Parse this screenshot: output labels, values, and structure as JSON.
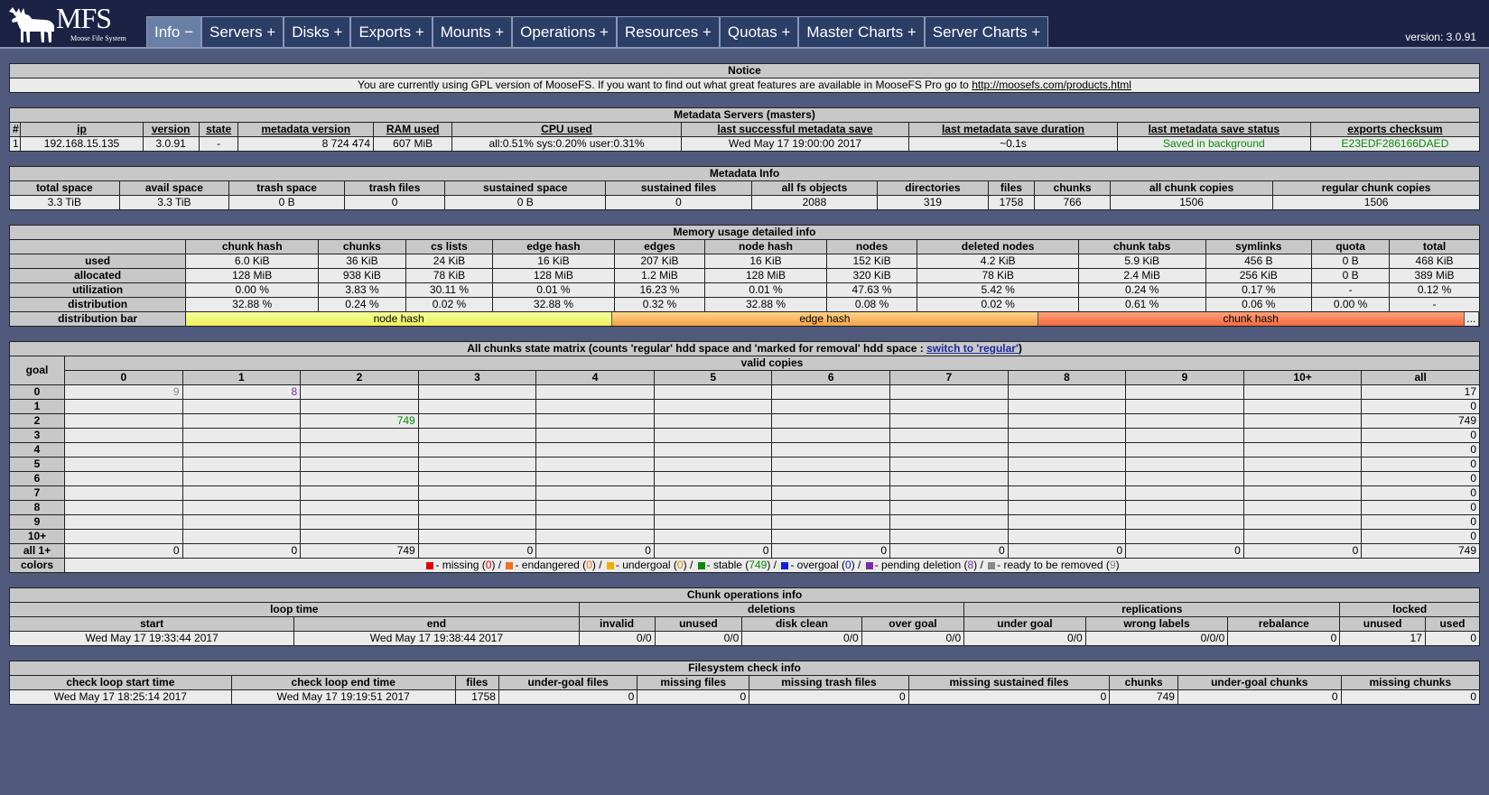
{
  "header": {
    "logo_text": "MFS",
    "logo_sub": "Moose File System",
    "version": "version: 3.0.91",
    "tabs": [
      {
        "label": "Info −",
        "active": true
      },
      {
        "label": "Servers +"
      },
      {
        "label": "Disks +"
      },
      {
        "label": "Exports +"
      },
      {
        "label": "Mounts +"
      },
      {
        "label": "Operations +"
      },
      {
        "label": "Resources +"
      },
      {
        "label": "Quotas +"
      },
      {
        "label": "Master Charts +"
      },
      {
        "label": "Server Charts +"
      }
    ]
  },
  "notice": {
    "title": "Notice",
    "text": "You are currently using GPL version of MooseFS. If you want to find out what great features are available in MooseFS Pro go to ",
    "link": "http://moosefs.com/products.html"
  },
  "masters": {
    "title": "Metadata Servers (masters)",
    "headers": [
      "#",
      "ip",
      "version",
      "state",
      "metadata version",
      "RAM used",
      "CPU used",
      "last successful metadata save",
      "last metadata save duration",
      "last metadata save status",
      "exports checksum"
    ],
    "row": [
      "1",
      "192.168.15.135",
      "3.0.91",
      "-",
      "8 724 474",
      "607 MiB",
      "all:0.51% sys:0.20% user:0.31%",
      "Wed May 17 19:00:00 2017",
      "~0.1s",
      "Saved in background",
      "E23EDF286166DAED"
    ]
  },
  "metainfo": {
    "title": "Metadata Info",
    "headers": [
      "total space",
      "avail space",
      "trash space",
      "trash files",
      "sustained space",
      "sustained files",
      "all fs objects",
      "directories",
      "files",
      "chunks",
      "all chunk copies",
      "regular chunk copies"
    ],
    "row": [
      "3.3 TiB",
      "3.3 TiB",
      "0 B",
      "0",
      "0 B",
      "0",
      "2088",
      "319",
      "1758",
      "766",
      "1506",
      "1506"
    ]
  },
  "memory": {
    "title": "Memory usage detailed info",
    "headers": [
      "chunk hash",
      "chunks",
      "cs lists",
      "edge hash",
      "edges",
      "node hash",
      "nodes",
      "deleted nodes",
      "chunk tabs",
      "symlinks",
      "quota",
      "total"
    ],
    "rows": [
      {
        "label": "used",
        "values": [
          "6.0 KiB",
          "36 KiB",
          "24 KiB",
          "16 KiB",
          "207 KiB",
          "16 KiB",
          "152 KiB",
          "4.2 KiB",
          "5.9 KiB",
          "456 B",
          "0 B",
          "468 KiB"
        ]
      },
      {
        "label": "allocated",
        "values": [
          "128 MiB",
          "938 KiB",
          "78 KiB",
          "128 MiB",
          "1.2 MiB",
          "128 MiB",
          "320 KiB",
          "78 KiB",
          "2.4 MiB",
          "256 KiB",
          "0 B",
          "389 MiB"
        ]
      },
      {
        "label": "utilization",
        "values": [
          "0.00 %",
          "3.83 %",
          "30.11 %",
          "0.01 %",
          "16.23 %",
          "0.01 %",
          "47.63 %",
          "5.42 %",
          "0.24 %",
          "0.17 %",
          "-",
          "0.12 %"
        ]
      },
      {
        "label": "distribution",
        "values": [
          "32.88 %",
          "0.24 %",
          "0.02 %",
          "32.88 %",
          "0.32 %",
          "32.88 %",
          "0.08 %",
          "0.02 %",
          "0.61 %",
          "0.06 %",
          "0.00 %",
          "-"
        ]
      }
    ],
    "bar_label": "distribution bar",
    "bar": [
      {
        "name": "node hash",
        "pct": 32.88
      },
      {
        "name": "edge hash",
        "pct": 32.88
      },
      {
        "name": "chunk hash",
        "pct": 32.88
      }
    ],
    "bar_more": "..."
  },
  "matrix": {
    "title": "All chunks state matrix (counts 'regular' hdd space and 'marked for removal' hdd space : ",
    "switch": "switch to 'regular'",
    "title_end": ")",
    "goal_label": "goal",
    "valid_label": "valid copies",
    "cols": [
      "0",
      "1",
      "2",
      "3",
      "4",
      "5",
      "6",
      "7",
      "8",
      "9",
      "10+",
      "all"
    ],
    "rows": [
      {
        "goal": "0",
        "cells": [
          "9",
          "8",
          "",
          "",
          "",
          "",
          "",
          "",
          "",
          "",
          "",
          "17"
        ]
      },
      {
        "goal": "1",
        "cells": [
          "",
          "",
          "",
          "",
          "",
          "",
          "",
          "",
          "",
          "",
          "",
          "0"
        ]
      },
      {
        "goal": "2",
        "cells": [
          "",
          "",
          "749",
          "",
          "",
          "",
          "",
          "",
          "",
          "",
          "",
          "749"
        ]
      },
      {
        "goal": "3",
        "cells": [
          "",
          "",
          "",
          "",
          "",
          "",
          "",
          "",
          "",
          "",
          "",
          "0"
        ]
      },
      {
        "goal": "4",
        "cells": [
          "",
          "",
          "",
          "",
          "",
          "",
          "",
          "",
          "",
          "",
          "",
          "0"
        ]
      },
      {
        "goal": "5",
        "cells": [
          "",
          "",
          "",
          "",
          "",
          "",
          "",
          "",
          "",
          "",
          "",
          "0"
        ]
      },
      {
        "goal": "6",
        "cells": [
          "",
          "",
          "",
          "",
          "",
          "",
          "",
          "",
          "",
          "",
          "",
          "0"
        ]
      },
      {
        "goal": "7",
        "cells": [
          "",
          "",
          "",
          "",
          "",
          "",
          "",
          "",
          "",
          "",
          "",
          "0"
        ]
      },
      {
        "goal": "8",
        "cells": [
          "",
          "",
          "",
          "",
          "",
          "",
          "",
          "",
          "",
          "",
          "",
          "0"
        ]
      },
      {
        "goal": "9",
        "cells": [
          "",
          "",
          "",
          "",
          "",
          "",
          "",
          "",
          "",
          "",
          "",
          "0"
        ]
      },
      {
        "goal": "10+",
        "cells": [
          "",
          "",
          "",
          "",
          "",
          "",
          "",
          "",
          "",
          "",
          "",
          "0"
        ]
      },
      {
        "goal": "all 1+",
        "cells": [
          "0",
          "0",
          "749",
          "0",
          "0",
          "0",
          "0",
          "0",
          "0",
          "0",
          "0",
          "749"
        ]
      }
    ],
    "colors_label": "colors",
    "legend": [
      {
        "color": "#e00000",
        "text": "- missing (",
        "n": "0",
        "tail": ") /",
        "ncolor": "#e00000"
      },
      {
        "color": "#f07020",
        "text": "- endangered (",
        "n": "0",
        "tail": ") /",
        "ncolor": "#f07020"
      },
      {
        "color": "#f0b000",
        "text": "- undergoal (",
        "n": "0",
        "tail": ") /",
        "ncolor": "#d09000"
      },
      {
        "color": "#0a8a0a",
        "text": "- stable (",
        "n": "749",
        "tail": ") /",
        "ncolor": "#0a8a0a"
      },
      {
        "color": "#1020e0",
        "text": "- overgoal (",
        "n": "0",
        "tail": ") /",
        "ncolor": "#1020e0"
      },
      {
        "color": "#7a2aa8",
        "text": "- pending deletion (",
        "n": "8",
        "tail": ") /",
        "ncolor": "#7a2aa8"
      },
      {
        "color": "#888888",
        "text": "- ready to be removed (",
        "n": "9",
        "tail": ")",
        "ncolor": "#888888"
      }
    ]
  },
  "chunkops": {
    "title": "Chunk operations info",
    "groups": [
      "loop time",
      "deletions",
      "replications",
      "locked"
    ],
    "headers": [
      "start",
      "end",
      "invalid",
      "unused",
      "disk clean",
      "over goal",
      "under goal",
      "wrong labels",
      "rebalance",
      "unused",
      "used"
    ],
    "row": [
      "Wed May 17 19:33:44 2017",
      "Wed May 17 19:38:44 2017",
      "0/0",
      "0/0",
      "0/0",
      "0/0",
      "0/0",
      "0/0/0",
      "0",
      "17",
      "0"
    ]
  },
  "fscheck": {
    "title": "Filesystem check info",
    "headers": [
      "check loop start time",
      "check loop end time",
      "files",
      "under-goal files",
      "missing files",
      "missing trash files",
      "missing sustained files",
      "chunks",
      "under-goal chunks",
      "missing chunks"
    ],
    "row": [
      "Wed May 17 18:25:14 2017",
      "Wed May 17 19:19:51 2017",
      "1758",
      "0",
      "0",
      "0",
      "0",
      "749",
      "0",
      "0"
    ]
  }
}
